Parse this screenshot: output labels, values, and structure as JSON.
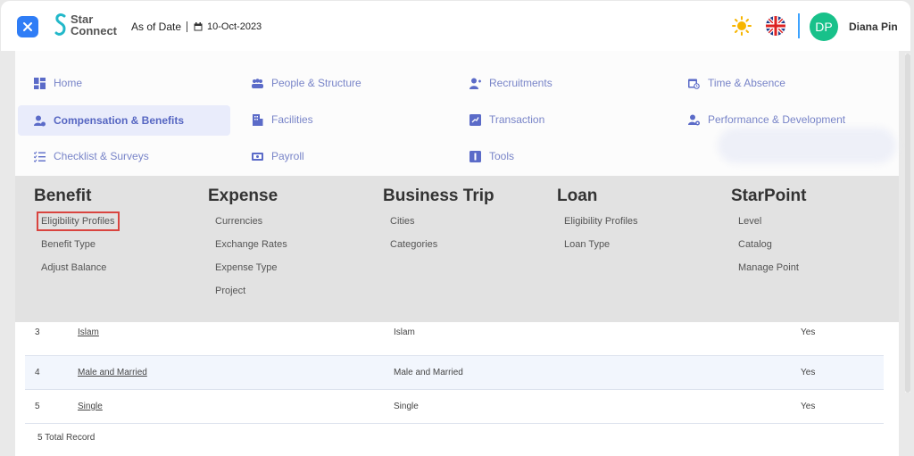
{
  "header": {
    "logo_line1": "Star",
    "logo_line2": "Connect",
    "as_of_label": "As of Date",
    "as_of_date": "10-Oct-2023",
    "avatar_initials": "DP",
    "user_name": "Diana Pin"
  },
  "menu": {
    "items": [
      {
        "label": "Home",
        "icon": "dashboard-icon"
      },
      {
        "label": "People & Structure",
        "icon": "people-icon"
      },
      {
        "label": "Recruitments",
        "icon": "user-add-icon"
      },
      {
        "label": "Time & Absence",
        "icon": "calendar-clock-icon"
      },
      {
        "label": "Compensation & Benefits",
        "icon": "user-money-icon",
        "active": true
      },
      {
        "label": "Facilities",
        "icon": "building-icon"
      },
      {
        "label": "Transaction",
        "icon": "transaction-icon"
      },
      {
        "label": "Performance & Development",
        "icon": "user-gear-icon"
      },
      {
        "label": "Checklist & Surveys",
        "icon": "checklist-icon"
      },
      {
        "label": "Payroll",
        "icon": "payroll-icon"
      },
      {
        "label": "Tools",
        "icon": "tools-icon"
      }
    ]
  },
  "submenu": {
    "benefit": {
      "title": "Benefit",
      "items": [
        "Eligibility Profiles",
        "Benefit Type",
        "Adjust Balance"
      ]
    },
    "expense": {
      "title": "Expense",
      "items": [
        "Currencies",
        "Exchange Rates",
        "Expense Type",
        "Project"
      ]
    },
    "business_trip": {
      "title": "Business Trip",
      "items": [
        "Cities",
        "Categories"
      ]
    },
    "loan": {
      "title": "Loan",
      "items": [
        "Eligibility Profiles",
        "Loan Type"
      ]
    },
    "starpoint": {
      "title": "StarPoint",
      "items": [
        "Level",
        "Catalog",
        "Manage Point"
      ]
    }
  },
  "table": {
    "rows": [
      {
        "no": "3",
        "name": "Islam",
        "description": "Islam",
        "active": "Yes"
      },
      {
        "no": "4",
        "name": "Male and Married",
        "description": "Male and Married",
        "active": "Yes"
      },
      {
        "no": "5",
        "name": "Single",
        "description": "Single",
        "active": "Yes"
      }
    ],
    "total_text": "5 Total Record"
  },
  "colors": {
    "accent_blue": "#2f7df6",
    "menu_text": "#7884c8",
    "avatar_green": "#18c18a",
    "highlight_red": "#d9443f"
  }
}
